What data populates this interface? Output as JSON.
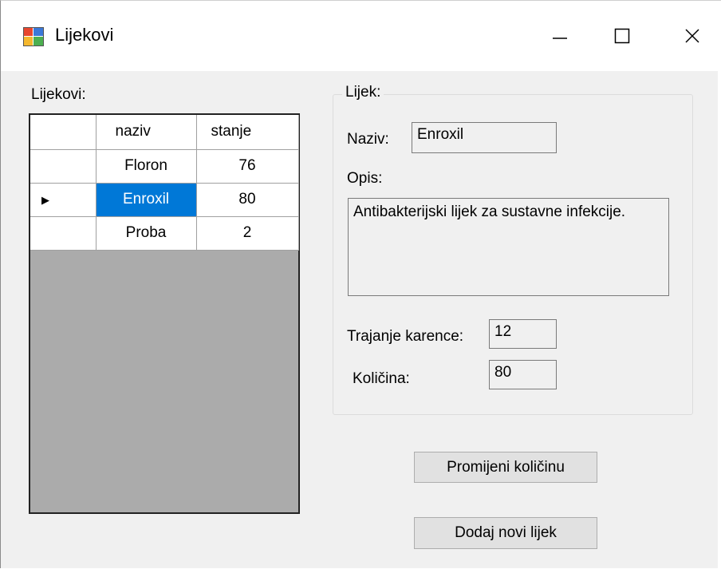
{
  "window": {
    "title": "Lijekovi",
    "minimize_glyph": "—",
    "maximize_glyph": "☐",
    "close_glyph": "✕"
  },
  "list_label": "Lijekovi:",
  "grid": {
    "columns": [
      "naziv",
      "stanje"
    ],
    "rows": [
      {
        "naziv": "Floron",
        "stanje": "76",
        "current": false
      },
      {
        "naziv": "Enroxil",
        "stanje": "80",
        "current": true
      },
      {
        "naziv": "Proba",
        "stanje": "2",
        "current": false
      }
    ],
    "current_row_glyph": "▶"
  },
  "details": {
    "group_title": "Lijek:",
    "naziv_label": "Naziv:",
    "naziv_value": "Enroxil",
    "opis_label": "Opis:",
    "opis_value": "Antibakterijski lijek za sustavne infekcije.",
    "trajanje_label": "Trajanje karence:",
    "trajanje_value": "12",
    "kolicina_label": "Količina:",
    "kolicina_value": "80"
  },
  "buttons": {
    "change_quantity": "Promijeni količinu",
    "add_new": "Dodaj novi lijek"
  },
  "colors": {
    "selection": "#0078d7",
    "window_bg": "#f0f0f0",
    "grid_empty_bg": "#ababab"
  }
}
